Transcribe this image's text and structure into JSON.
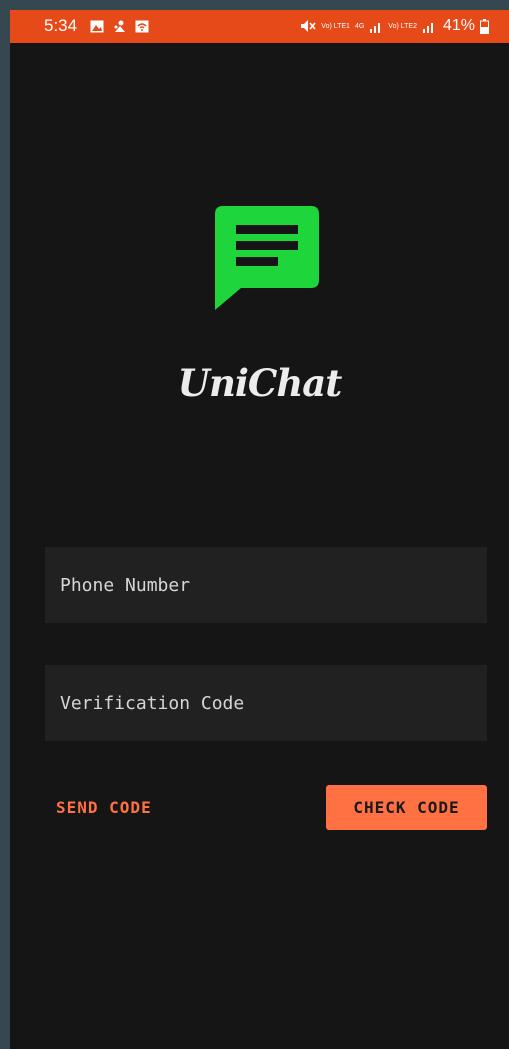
{
  "status_bar": {
    "time": "5:34",
    "network_1": "Vo) LTE1",
    "network_2": "4G",
    "network_3": "Vo) LTE2",
    "battery": "41%",
    "icons": [
      "gallery-icon",
      "notification-icon",
      "wifi-call-icon",
      "mute-icon",
      "signal-icon",
      "battery-icon"
    ]
  },
  "app": {
    "name": "UniChat",
    "logo_color": "#1ed63c"
  },
  "form": {
    "phone_placeholder": "Phone Number",
    "phone_value": "",
    "code_placeholder": "Verification Code",
    "code_value": ""
  },
  "actions": {
    "send_label": "SEND CODE",
    "check_label": "CHECK CODE"
  },
  "colors": {
    "status_bar": "#e64a19",
    "accent": "#ff7043",
    "background": "#151515",
    "input_bg": "#212121"
  }
}
